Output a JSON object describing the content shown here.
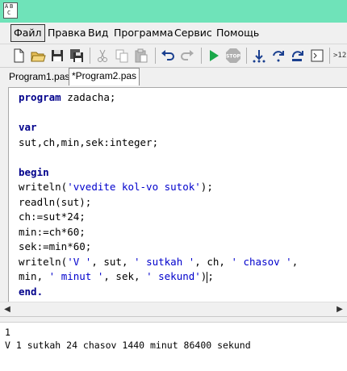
{
  "menu": [
    "Файл",
    "Правка",
    "Вид",
    "Программа",
    "Сервис",
    "Помощь"
  ],
  "toolbar": {
    "icons": [
      "new-file-icon",
      "open-folder-icon",
      "save-icon",
      "save-all-icon",
      "cut-icon",
      "copy-icon",
      "paste-icon",
      "undo-icon",
      "redo-icon",
      "run-icon",
      "stop-icon",
      "step-into-icon",
      "step-over-icon",
      "step-out-icon",
      "console-icon"
    ],
    "extra_label": ">12"
  },
  "tabs": [
    {
      "label": "Program1.pas",
      "active": false
    },
    {
      "label": "*Program2.pas",
      "active": true
    }
  ],
  "editor": {
    "lines": [
      [
        {
          "t": "program",
          "k": "kw"
        },
        {
          "t": " zadacha;",
          "k": ""
        }
      ],
      [],
      [
        {
          "t": "var",
          "k": "kw"
        }
      ],
      [
        {
          "t": "sut,ch,min,sek:integer;",
          "k": ""
        }
      ],
      [],
      [
        {
          "t": "begin",
          "k": "kw"
        }
      ],
      [
        {
          "t": "writeln(",
          "k": ""
        },
        {
          "t": "'vvedite kol-vo sutok'",
          "k": "str"
        },
        {
          "t": ");",
          "k": ""
        }
      ],
      [
        {
          "t": "readln(sut);",
          "k": ""
        }
      ],
      [
        {
          "t": "ch:=sut*24;",
          "k": ""
        }
      ],
      [
        {
          "t": "min:=ch*60;",
          "k": ""
        }
      ],
      [
        {
          "t": "sek:=min*60;",
          "k": ""
        }
      ],
      [
        {
          "t": "writeln(",
          "k": ""
        },
        {
          "t": "'V '",
          "k": "str"
        },
        {
          "t": ", sut, ",
          "k": ""
        },
        {
          "t": "' sutkah '",
          "k": "str"
        },
        {
          "t": ", ch, ",
          "k": ""
        },
        {
          "t": "' chasov '",
          "k": "str"
        },
        {
          "t": ",",
          "k": ""
        }
      ],
      [
        {
          "t": "min, ",
          "k": ""
        },
        {
          "t": "' minut '",
          "k": "str"
        },
        {
          "t": ", sek, ",
          "k": ""
        },
        {
          "t": "' sekund'",
          "k": "str"
        },
        {
          "t": ")",
          "k": ""
        },
        {
          "t": "caret",
          "k": "caret"
        },
        {
          "t": ";",
          "k": ""
        }
      ],
      [
        {
          "t": "end.",
          "k": "kw"
        }
      ]
    ]
  },
  "output": {
    "lines": [
      "1",
      "V 1 sutkah 24 chasov 1440 minut 86400 sekund"
    ]
  },
  "colors": {
    "titlebar": "#6fe3b9",
    "keyword": "#00008b",
    "string": "#0000cc"
  }
}
